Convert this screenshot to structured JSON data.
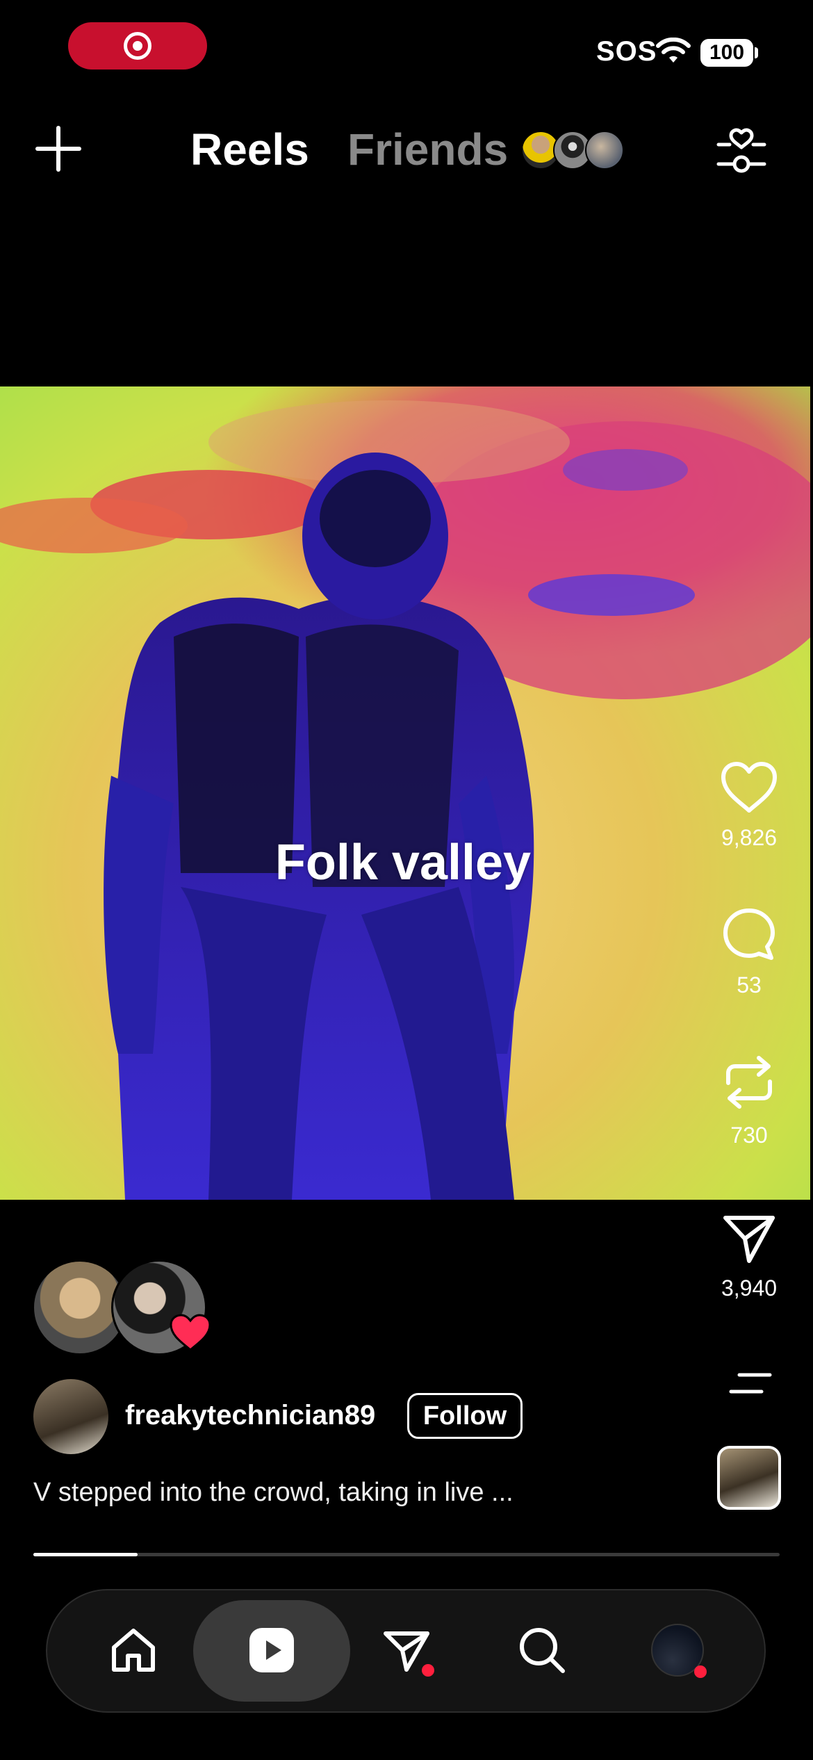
{
  "status_bar": {
    "sos_label": "SOS",
    "battery_level": "100",
    "recording_indicator_color": "#c8102e"
  },
  "top_nav": {
    "tabs": [
      {
        "label": "Reels",
        "active": true
      },
      {
        "label": "Friends",
        "active": false
      }
    ],
    "icons": {
      "create": "plus-icon",
      "filter": "heart-sliders-icon"
    }
  },
  "reel": {
    "on_video_caption": "Folk valley",
    "actions": [
      {
        "name": "like",
        "icon": "heart-icon",
        "count": "9,826"
      },
      {
        "name": "comment",
        "icon": "comment-icon",
        "count": "53"
      },
      {
        "name": "repost",
        "icon": "repost-icon",
        "count": "730"
      },
      {
        "name": "share",
        "icon": "send-icon",
        "count": "3,940"
      }
    ],
    "author": {
      "username": "freakytechnician89",
      "follow_label": "Follow"
    },
    "caption": "V stepped into the crowd, taking in live ...",
    "progress": 0.14
  },
  "bottom_nav": {
    "items": [
      {
        "name": "home",
        "icon": "home-icon"
      },
      {
        "name": "reels",
        "icon": "reels-icon",
        "active": true
      },
      {
        "name": "messages",
        "icon": "send-icon",
        "badge": true
      },
      {
        "name": "search",
        "icon": "search-icon"
      },
      {
        "name": "profile",
        "icon": "avatar",
        "badge": true
      }
    ]
  },
  "colors": {
    "background": "#000000",
    "accent_red": "#ff1f3d",
    "inactive_tab": "#8a8a8a"
  }
}
